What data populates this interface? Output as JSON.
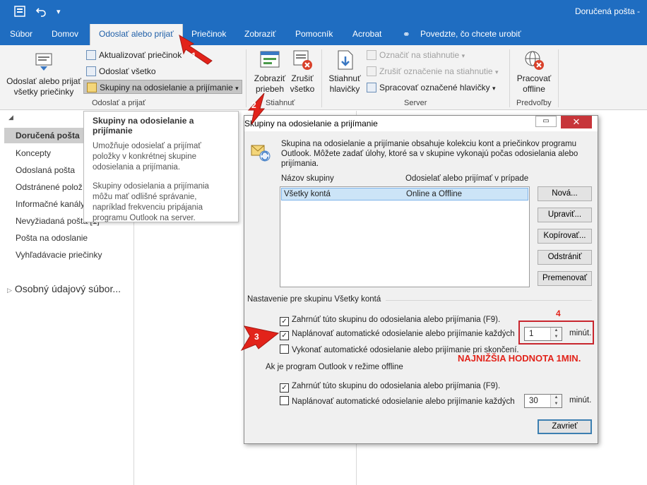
{
  "window": {
    "title": "Doručená pošta - "
  },
  "tabs": [
    {
      "label": "Súbor"
    },
    {
      "label": "Domov"
    },
    {
      "label": "Odoslať alebo prijať"
    },
    {
      "label": "Priečinok"
    },
    {
      "label": "Zobraziť"
    },
    {
      "label": "Pomocník"
    },
    {
      "label": "Acrobat"
    },
    {
      "label": "Povedzte, čo chcete urobiť"
    }
  ],
  "ribbon": {
    "send_receive_all": "Odoslať alebo prijať\nvšetky priečinky",
    "update_folder": "Aktualizovať priečinok",
    "send_all": "Odoslať všetko",
    "send_receive_groups": "Skupiny na odosielanie a prijímanie",
    "group_send_receive_label": "Odoslať a prijať",
    "show_progress": "Zobraziť\npriebeh",
    "cancel_all": "Zrušiť\nvšetko",
    "download_label": "Stiahnuť",
    "download_headers": "Stiahnuť\nhlavičky",
    "mark_download": "Označiť na stiahnutie",
    "unmark_download": "Zrušiť označenie na stiahnutie",
    "process_headers": "Spracovať označené hlavičky",
    "server_label": "Server",
    "work_offline": "Pracovať\noffline",
    "preferences_label": "Predvoľby"
  },
  "navpane": {
    "items": [
      {
        "label": "Doručená pošta"
      },
      {
        "label": "Koncepty"
      },
      {
        "label": "Odoslaná pošta"
      },
      {
        "label": "Odstránené polož"
      },
      {
        "label": "Informačné kanály"
      },
      {
        "label": "Nevyžiadaná pošta [1]"
      },
      {
        "label": "Pošta na odoslanie"
      },
      {
        "label": "Vyhľadávacie priečinky"
      }
    ],
    "data_file": "Osobný údajový súbor..."
  },
  "tooltip": {
    "title": "Skupiny na odosielanie a prijímanie",
    "text1": "Umožňuje odosielať a prijímať položky v konkrétnej skupine odosielania a prijímania.",
    "text2": "Skupiny odosielania a prijímania môžu mať odlišné správanie, napríklad frekvenciu pripájania programu Outlook na server."
  },
  "dialog": {
    "title": "Skupiny na odosielanie a prijímanie",
    "description": "Skupina na odosielanie a prijímanie obsahuje kolekciu kont a priečinkov programu Outlook. Môžete zadať úlohy, ktoré sa v skupine vykonajú počas odosielania alebo prijímania.",
    "col_group_name": "Názov skupiny",
    "col_send_receive": "Odosielať alebo prijímať v prípade",
    "rows": [
      {
        "name": "Všetky kontá",
        "when": "Online a Offline"
      }
    ],
    "btn_new": "Nová...",
    "btn_edit": "Upraviť...",
    "btn_copy": "Kopírovať...",
    "btn_remove": "Odstrániť",
    "btn_rename": "Premenovať",
    "btn_close": "Zavrieť",
    "section_group": "Nastavenie pre skupinu Všetky kontá",
    "include_group": "Zahrnúť túto skupinu do odosielania alebo prijímania (F9).",
    "schedule_auto": "Naplánovať automatické odosielanie alebo prijímanie každých",
    "schedule_value": "1",
    "minutes": "minút.",
    "on_exit": "Vykonať automatické odosielanie alebo prijímanie pri skončení.",
    "section_offline": "Ak je program Outlook v režime offline",
    "offline_include": "Zahrnúť túto skupinu do odosielania alebo prijímania (F9).",
    "offline_schedule": "Naplánovať automatické odosielanie alebo prijímanie každých",
    "offline_value": "30",
    "offline_minutes": "minút."
  },
  "annotations": {
    "n1": "1",
    "n2": "2",
    "n3": "3",
    "n4": "4",
    "note": "NAJNIŽŠIA HODNOTA 1MIN.",
    "color": "#e2231a"
  }
}
